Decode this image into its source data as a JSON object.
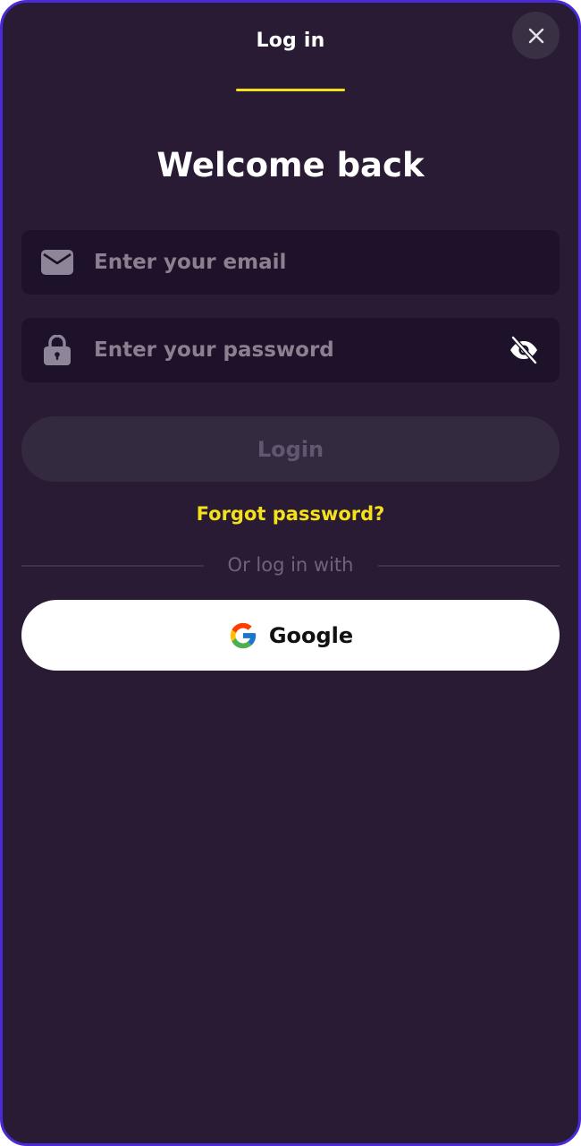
{
  "header": {
    "tab_title": "Log in",
    "close_icon": "close-icon"
  },
  "main": {
    "heading": "Welcome back",
    "email": {
      "value": "",
      "placeholder": "Enter your email",
      "icon": "envelope-icon"
    },
    "password": {
      "value": "",
      "placeholder": "Enter your password",
      "icon": "lock-icon",
      "toggle_icon": "eye-slash-icon"
    },
    "login_label": "Login",
    "forgot_label": "Forgot password?",
    "divider_label": "Or log in with",
    "google_label": "Google",
    "google_icon": "google-icon"
  },
  "colors": {
    "accent": "#f5e11a",
    "background": "#281b33",
    "border": "#4a2ad6",
    "input_bg": "#1d1229"
  }
}
